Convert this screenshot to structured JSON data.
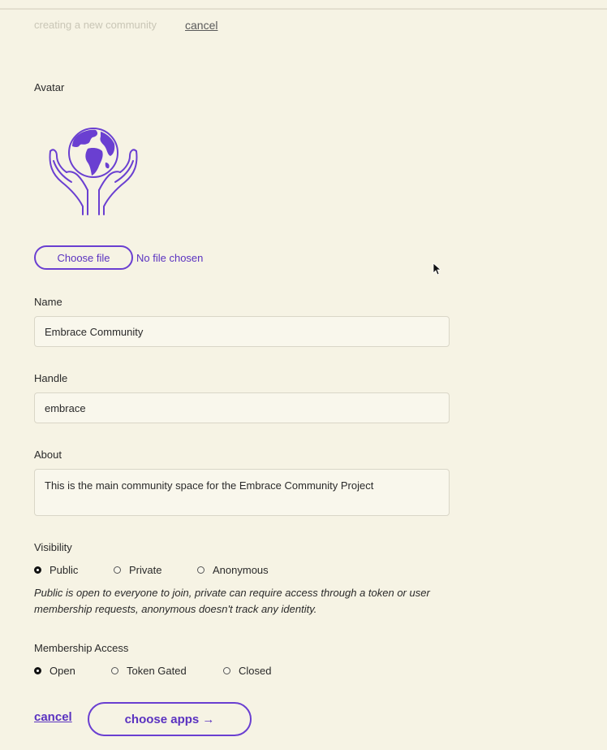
{
  "header": {
    "status_text": "creating a new community",
    "cancel_label": "cancel"
  },
  "avatar": {
    "label": "Avatar",
    "icon": "globe-in-hands-icon",
    "choose_file_label": "Choose file",
    "no_file_text": "No file chosen"
  },
  "name": {
    "label": "Name",
    "value": "Embrace Community"
  },
  "handle": {
    "label": "Handle",
    "value": "embrace"
  },
  "about": {
    "label": "About",
    "value": "This is the main community space for the Embrace Community Project"
  },
  "visibility": {
    "label": "Visibility",
    "options": [
      {
        "label": "Public",
        "checked": true
      },
      {
        "label": "Private",
        "checked": false
      },
      {
        "label": "Anonymous",
        "checked": false
      }
    ],
    "help_text": "Public is open to everyone to join, private can require access through a token or user membership requests, anonymous doesn't track any identity."
  },
  "membership": {
    "label": "Membership Access",
    "options": [
      {
        "label": "Open",
        "checked": true
      },
      {
        "label": "Token Gated",
        "checked": false
      },
      {
        "label": "Closed",
        "checked": false
      }
    ]
  },
  "footer": {
    "cancel_label": "cancel",
    "choose_apps_label": "choose apps →"
  },
  "colors": {
    "background": "#f6f3e4",
    "accent": "#5a32c0",
    "accent_border": "#6a3fd1"
  }
}
